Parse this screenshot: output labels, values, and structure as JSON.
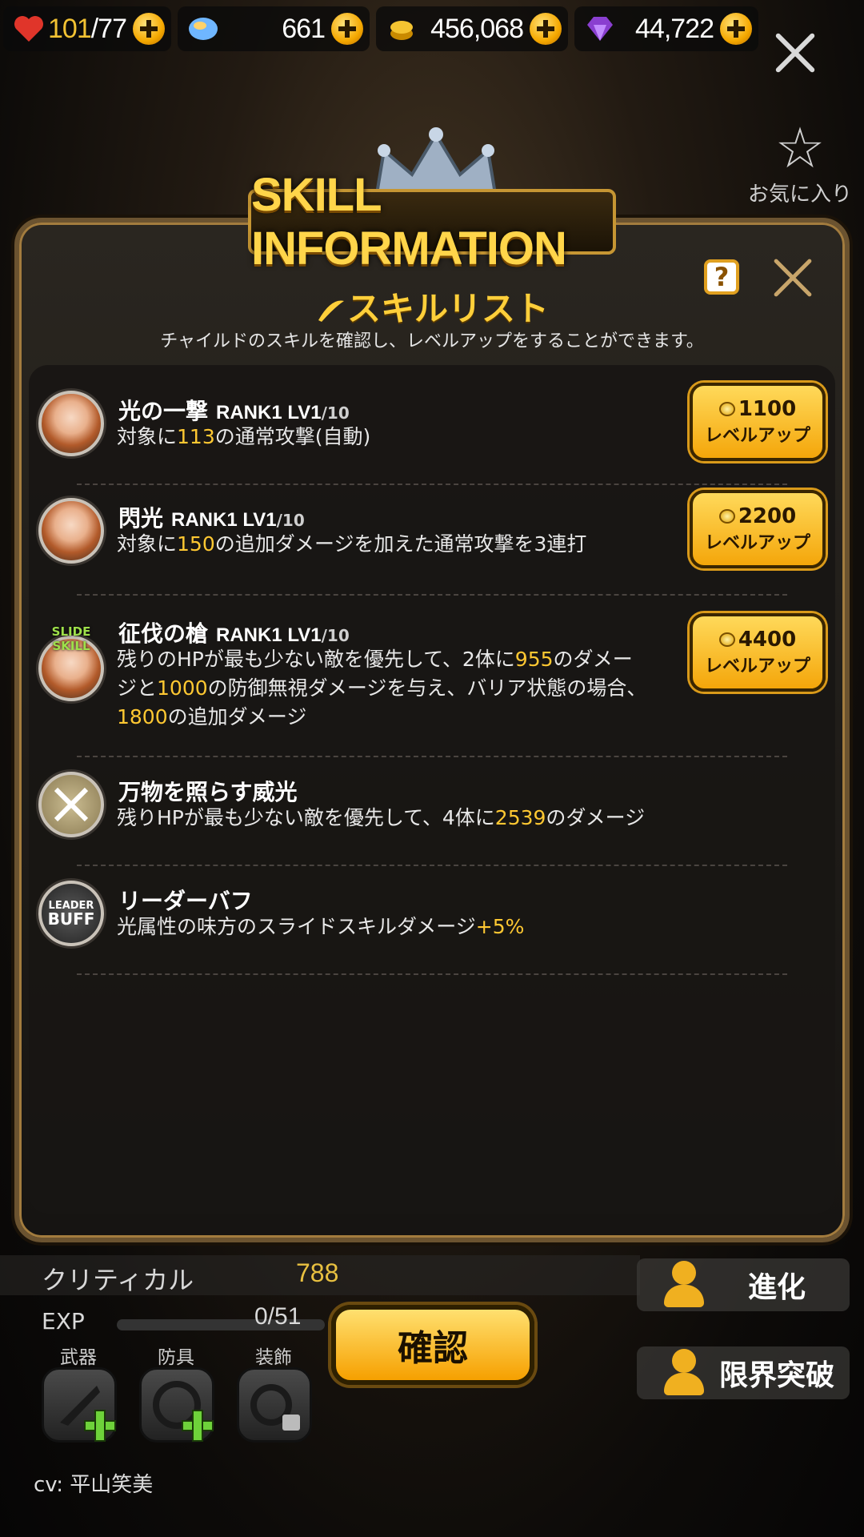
{
  "resources": {
    "stamina_current": "101",
    "stamina_max": "/77",
    "crystal": "661",
    "gold": "456,068",
    "gem": "44,722"
  },
  "favorite_label": "お気に入り",
  "dialog": {
    "title": "SKILL INFORMATION",
    "heading": "スキルリスト",
    "subheading": "チャイルドのスキルを確認し、レベルアップをすることができます。",
    "help_label": "?"
  },
  "skills": [
    {
      "name": "光の一撃",
      "rank": "RANK1 LV1",
      "lvmax": "/10",
      "desc_pre": "対象に",
      "desc_hl": "113",
      "desc_post": "の通常攻撃(自動)",
      "cost": "1100",
      "button": "レベルアップ"
    },
    {
      "name": "閃光",
      "rank": "RANK1 LV1",
      "lvmax": "/10",
      "desc_pre": "対象に",
      "desc_hl": "150",
      "desc_post": "の追加ダメージを加えた通常攻撃を3連打",
      "cost": "2200",
      "button": "レベルアップ"
    },
    {
      "name": "征伐の槍",
      "rank": "RANK1 LV1",
      "lvmax": "/10",
      "badge": "SLIDE SKILL",
      "desc_l1_pre": "残りのHPが最も少ない敵を優先して、2体に",
      "desc_l1_hl": "955",
      "desc_l1_post": "のダメー",
      "desc_l2_pre": "ジと",
      "desc_l2_hl": "1000",
      "desc_l2_post": "の防御無視ダメージを与え、バリア状態の場合、",
      "desc_l3_hl": "1800",
      "desc_l3_post": "の追加ダメージ",
      "cost": "4400",
      "button": "レベルアップ"
    },
    {
      "name": "万物を照らす威光",
      "desc_pre": "残りHPが最も少ない敵を優先して、4体に",
      "desc_hl": "2539",
      "desc_post": "のダメージ"
    },
    {
      "name": "リーダーバフ",
      "icon_text_1": "LEADER",
      "icon_text_2": "BUFF",
      "desc_pre": "光属性の味方のスライドスキルダメージ",
      "desc_hl": "+5%"
    }
  ],
  "stats": {
    "crit_label": "クリティカル",
    "crit_value": "788"
  },
  "exp": {
    "label": "EXP",
    "value": "0/51",
    "progress": 0
  },
  "confirm_label": "確認",
  "equipment": {
    "weapon": "武器",
    "armor": "防具",
    "accessory": "装飾"
  },
  "side_buttons": {
    "evolve": "進化",
    "limit_break": "限界突破"
  },
  "cv": "cv: 平山笑美",
  "colors": {
    "accent": "#ffc832",
    "button": "#f6a000",
    "panel_border": "#6b5330"
  }
}
